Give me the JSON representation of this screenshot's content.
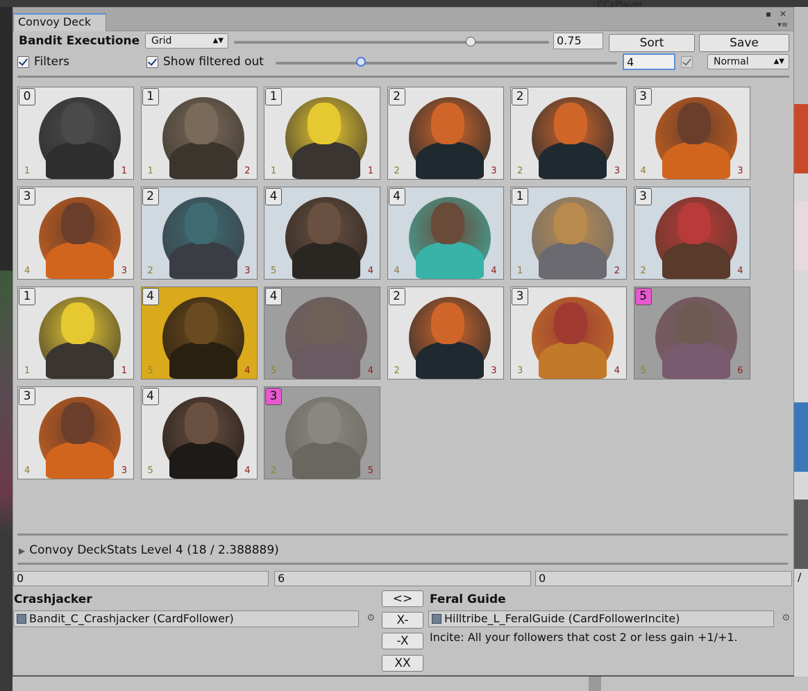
{
  "background": {
    "title_fragment": "CCxPlayer"
  },
  "window": {
    "tab_title": "Convoy Deck",
    "deck_name": "Bandit Executione",
    "layout_dropdown": "Grid",
    "zoom_slider_value": 0.75,
    "zoom_field": "0.75",
    "sort_label": "Sort",
    "save_label": "Save",
    "filters_label": "Filters",
    "show_filtered_label": "Show filtered out",
    "level_slider_value": 0.25,
    "level_field": "4",
    "mode_dropdown": "Normal"
  },
  "cards": [
    {
      "cost": "0",
      "atk": "1",
      "hp": "1",
      "bg": "#e4e4e4",
      "skin": "#4a4a4a",
      "body": "#2e2e2e",
      "pink": false
    },
    {
      "cost": "1",
      "atk": "1",
      "hp": "2",
      "bg": "#e4e4e4",
      "skin": "#7a6a5a",
      "body": "#3b352e",
      "pink": false
    },
    {
      "cost": "1",
      "atk": "1",
      "hp": "1",
      "bg": "#e4e4e4",
      "skin": "#e6c830",
      "body": "#3a3530",
      "pink": false
    },
    {
      "cost": "2",
      "atk": "2",
      "hp": "3",
      "bg": "#e4e4e4",
      "skin": "#d0652a",
      "body": "#1f2a30",
      "pink": false
    },
    {
      "cost": "2",
      "atk": "2",
      "hp": "3",
      "bg": "#e4e4e4",
      "skin": "#d0652a",
      "body": "#1f2a30",
      "pink": false
    },
    {
      "cost": "3",
      "atk": "4",
      "hp": "3",
      "bg": "#e4e4e4",
      "skin": "#6a3e2a",
      "body": "#d2651e",
      "pink": false
    },
    {
      "cost": "3",
      "atk": "4",
      "hp": "3",
      "bg": "#e4e4e4",
      "skin": "#6a3e2a",
      "body": "#d2651e",
      "pink": false
    },
    {
      "cost": "2",
      "atk": "2",
      "hp": "3",
      "bg": "#d0d8e0",
      "skin": "#3e6a72",
      "body": "#3a3e44",
      "pink": false
    },
    {
      "cost": "4",
      "atk": "5",
      "hp": "4",
      "bg": "#d0d8e0",
      "skin": "#6a5040",
      "body": "#2a2622",
      "pink": false
    },
    {
      "cost": "4",
      "atk": "4",
      "hp": "4",
      "bg": "#d0d8e0",
      "skin": "#6a4a38",
      "body": "#39b3a8",
      "pink": false
    },
    {
      "cost": "1",
      "atk": "1",
      "hp": "2",
      "bg": "#d0d8e0",
      "skin": "#b88a4e",
      "body": "#6a6a70",
      "pink": false
    },
    {
      "cost": "3",
      "atk": "2",
      "hp": "4",
      "bg": "#d0d8e0",
      "skin": "#b83a3a",
      "body": "#5a3a2a",
      "pink": false
    },
    {
      "cost": "1",
      "atk": "1",
      "hp": "1",
      "bg": "#e4e4e4",
      "skin": "#e6c830",
      "body": "#3a3530",
      "pink": false
    },
    {
      "cost": "4",
      "atk": "5",
      "hp": "4",
      "bg": "#dbaa1c",
      "skin": "#6a4a20",
      "body": "#2a2010",
      "pink": false
    },
    {
      "cost": "4",
      "atk": "5",
      "hp": "4",
      "bg": "#9e9e9e",
      "skin": "#6e6258",
      "body": "#6a5a62",
      "pink": false
    },
    {
      "cost": "2",
      "atk": "2",
      "hp": "3",
      "bg": "#e4e4e4",
      "skin": "#d0652a",
      "body": "#1f2a30",
      "pink": false
    },
    {
      "cost": "3",
      "atk": "3",
      "hp": "4",
      "bg": "#e4e4e4",
      "skin": "#a03a30",
      "body": "#c27a2a",
      "pink": false
    },
    {
      "cost": "5",
      "atk": "5",
      "hp": "6",
      "bg": "#9e9e9e",
      "skin": "#6e5a50",
      "body": "#7a5a6e",
      "pink": true
    },
    {
      "cost": "3",
      "atk": "4",
      "hp": "3",
      "bg": "#e4e4e4",
      "skin": "#6a3e2a",
      "body": "#d2651e",
      "pink": false
    },
    {
      "cost": "4",
      "atk": "5",
      "hp": "4",
      "bg": "#e4e4e4",
      "skin": "#6a5040",
      "body": "#1e1a18",
      "pink": false
    },
    {
      "cost": "3",
      "atk": "2",
      "hp": "5",
      "bg": "#9e9e9e",
      "skin": "#8a8680",
      "body": "#6a6660",
      "pink": true
    }
  ],
  "stats": {
    "foldout_label": "Convoy DeckStats Level 4 (18 / 2.388889)",
    "field_a": "0",
    "field_b": "6",
    "field_c": "0",
    "slash": "/"
  },
  "compare": {
    "left_title": "Crashjacker",
    "left_object": "Bandit_C_Crashjacker (CardFollower)",
    "right_title": "Feral Guide",
    "right_object": "Hilltribe_L_FeralGuide (CardFollowerIncite)",
    "right_desc": "Incite: All your followers that cost 2 or less gain +1/+1.",
    "btn_swap": "<>",
    "btn_xminus": "X-",
    "btn_minusx": "-X",
    "btn_xx": "XX"
  }
}
